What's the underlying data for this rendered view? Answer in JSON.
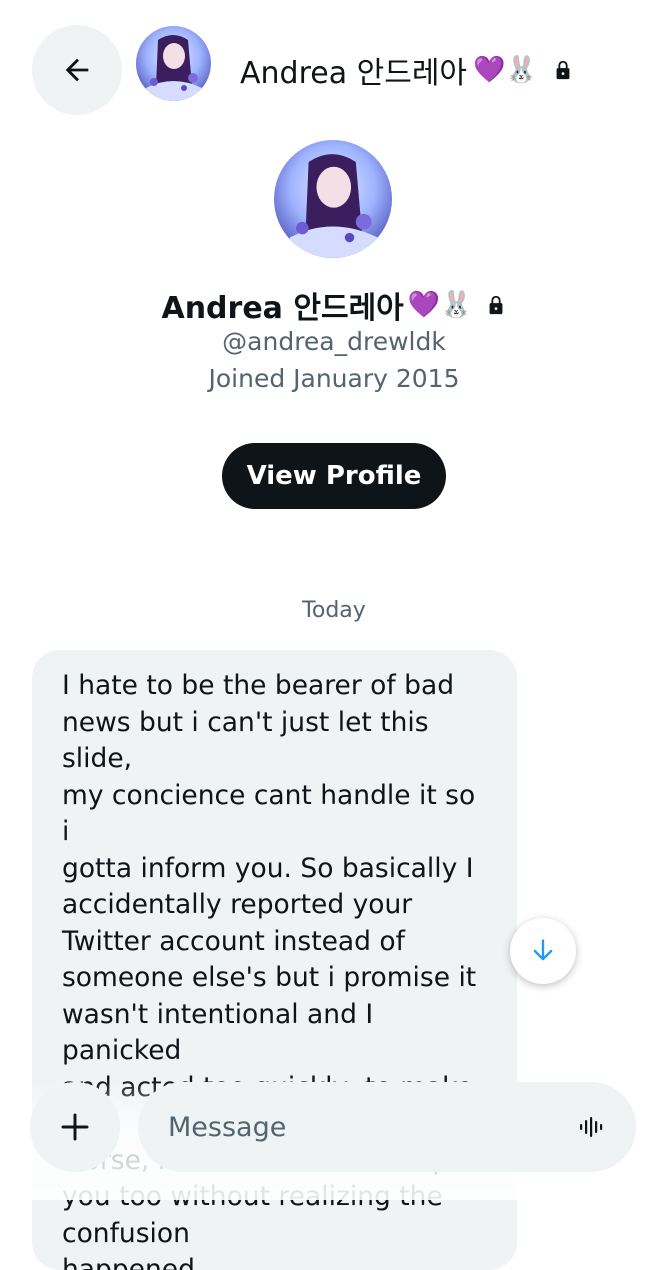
{
  "header": {
    "title": "Andrea 안드레아",
    "emoji": "💜🐰"
  },
  "profile": {
    "name": "Andrea 안드레아",
    "emoji": "💜🐰",
    "handle": "@andrea_drewldk",
    "joined": "Joined January 2015",
    "view_profile_label": "View Profile"
  },
  "conversation": {
    "date_separator": "Today",
    "messages": [
      {
        "text": "I hate to be the bearer of bad\nnews but i can't just let this slide,\nmy concience cant handle it so i\ngotta inform you. So basically I\naccidentally reported your\nTwitter account instead of\nsomeone else's but i promise it\nwasn't intentional and I panicked\nand acted too quickly, to make it\nworse, I asked a friend to report\nyou too without realizing the\nconfusion\nhappened\nabout a couple of hours your"
      }
    ]
  },
  "composer": {
    "placeholder": "Message"
  },
  "colors": {
    "background": "#ffffff",
    "bubble": "#eff3f4",
    "button_dark": "#0f1419",
    "secondary_text": "#536471",
    "accent": "#1d9bf0"
  },
  "icons": [
    "back-arrow-icon",
    "lock-icon",
    "arrow-down-icon",
    "plus-icon",
    "voice-icon"
  ]
}
